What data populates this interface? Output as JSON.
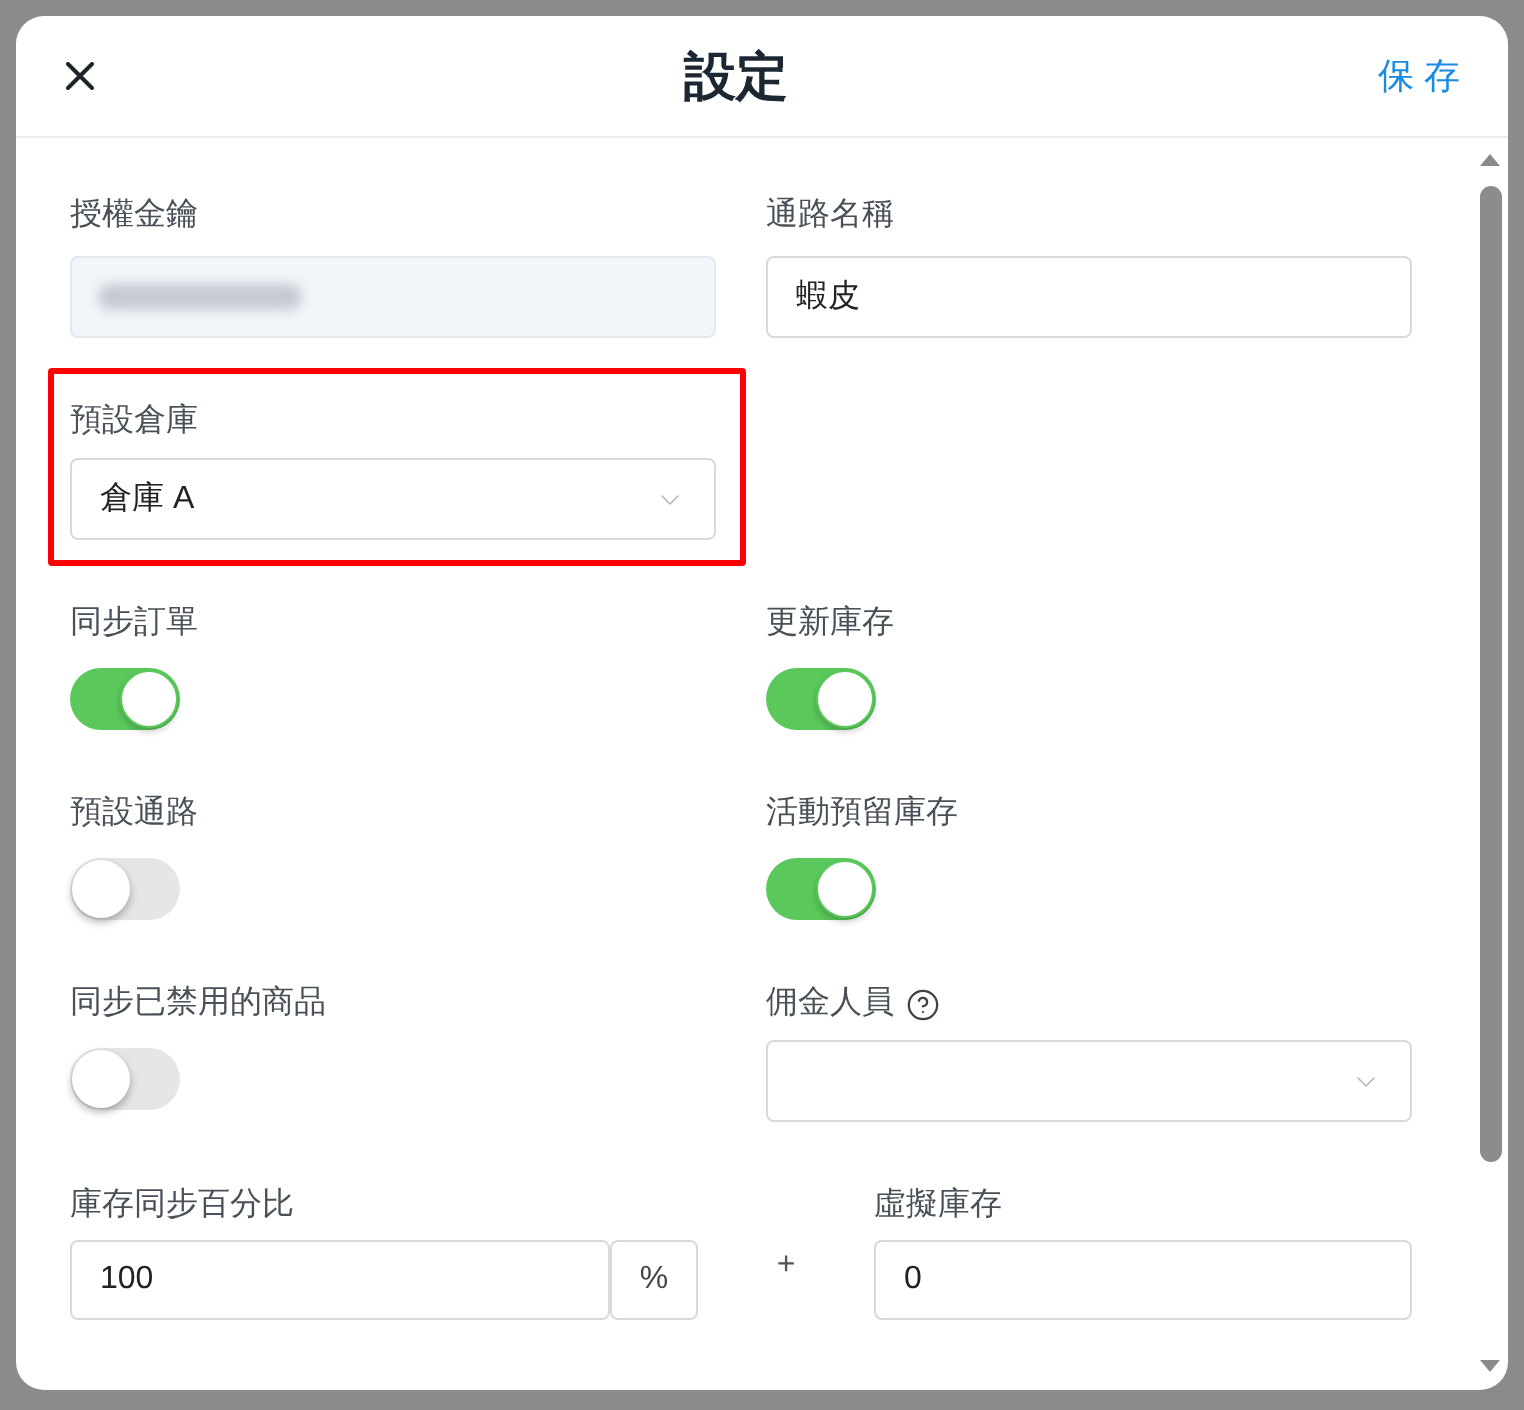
{
  "dialog": {
    "title": "設定",
    "save_button": "保 存"
  },
  "rows": [
    {
      "fields": [
        {
          "kind": "masked",
          "label": "授權金鑰"
        },
        {
          "kind": "text",
          "label": "通路名稱",
          "value": "蝦皮"
        }
      ]
    },
    {
      "fields": [
        {
          "kind": "select",
          "label": "預設倉庫",
          "value": "倉庫 A",
          "highlighted": true
        }
      ]
    },
    {
      "fields": [
        {
          "kind": "toggle",
          "label": "同步訂單",
          "on": true
        },
        {
          "kind": "toggle",
          "label": "更新庫存",
          "on": true
        }
      ]
    },
    {
      "fields": [
        {
          "kind": "toggle",
          "label": "預設通路",
          "on": false
        },
        {
          "kind": "toggle",
          "label": "活動預留庫存",
          "on": true
        }
      ]
    },
    {
      "fields": [
        {
          "kind": "toggle",
          "label": "同步已禁用的商品",
          "on": false
        },
        {
          "kind": "select",
          "label": "佣金人員",
          "help": true
        }
      ]
    }
  ],
  "stock_formula": {
    "percent": {
      "label": "庫存同步百分比",
      "value": "100",
      "unit": "%"
    },
    "operator": "+",
    "virtual": {
      "label": "虛擬庫存",
      "value": "0"
    }
  }
}
